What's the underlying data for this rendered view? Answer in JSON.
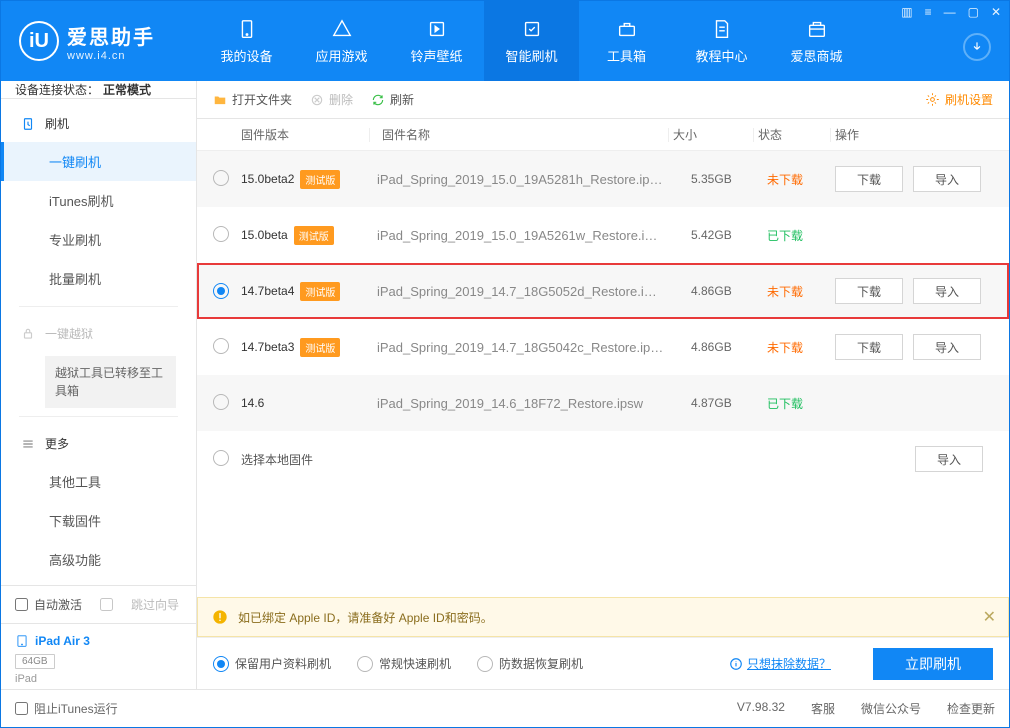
{
  "brand": {
    "cn": "爱思助手",
    "url": "www.i4.cn",
    "logo_letter": "iU"
  },
  "nav": [
    {
      "label": "我的设备"
    },
    {
      "label": "应用游戏"
    },
    {
      "label": "铃声壁纸"
    },
    {
      "label": "智能刷机"
    },
    {
      "label": "工具箱"
    },
    {
      "label": "教程中心"
    },
    {
      "label": "爱思商城"
    }
  ],
  "nav_active_index": 3,
  "conn_status": {
    "label": "设备连接状态：",
    "value": "正常模式"
  },
  "sidebar": {
    "flash": {
      "title": "刷机",
      "items": [
        "一键刷机",
        "iTunes刷机",
        "专业刷机",
        "批量刷机"
      ],
      "selected": 0
    },
    "jailbreak": {
      "title": "一键越狱",
      "note": "越狱工具已转移至工具箱"
    },
    "more": {
      "title": "更多",
      "items": [
        "其他工具",
        "下载固件",
        "高级功能"
      ]
    },
    "auto_activate": "自动激活",
    "skip_guide": "跳过向导",
    "device": {
      "name": "iPad Air 3",
      "capacity": "64GB",
      "model": "iPad"
    }
  },
  "toolbar": {
    "open": "打开文件夹",
    "delete": "删除",
    "refresh": "刷新",
    "settings": "刷机设置"
  },
  "thead": {
    "version": "固件版本",
    "name": "固件名称",
    "size": "大小",
    "status": "状态",
    "ops": "操作"
  },
  "beta_tag": "测试版",
  "rows": [
    {
      "ver": "15.0beta2",
      "beta": true,
      "name": "iPad_Spring_2019_15.0_19A5281h_Restore.ip…",
      "size": "5.35GB",
      "status": "未下载",
      "status_ok": false,
      "ops": true,
      "selected": false
    },
    {
      "ver": "15.0beta",
      "beta": true,
      "name": "iPad_Spring_2019_15.0_19A5261w_Restore.i…",
      "size": "5.42GB",
      "status": "已下载",
      "status_ok": true,
      "ops": false,
      "selected": false
    },
    {
      "ver": "14.7beta4",
      "beta": true,
      "name": "iPad_Spring_2019_14.7_18G5052d_Restore.i…",
      "size": "4.86GB",
      "status": "未下载",
      "status_ok": false,
      "ops": true,
      "selected": true,
      "highlight": true
    },
    {
      "ver": "14.7beta3",
      "beta": true,
      "name": "iPad_Spring_2019_14.7_18G5042c_Restore.ip…",
      "size": "4.86GB",
      "status": "未下载",
      "status_ok": false,
      "ops": true,
      "selected": false
    },
    {
      "ver": "14.6",
      "beta": false,
      "name": "iPad_Spring_2019_14.6_18F72_Restore.ipsw",
      "size": "4.87GB",
      "status": "已下载",
      "status_ok": true,
      "ops": false,
      "selected": false
    }
  ],
  "local_row": {
    "label": "选择本地固件",
    "import": "导入"
  },
  "btn": {
    "download": "下载",
    "import": "导入"
  },
  "alert": "如已绑定 Apple ID，请准备好 Apple ID和密码。",
  "options": [
    {
      "label": "保留用户资料刷机",
      "selected": true
    },
    {
      "label": "常规快速刷机",
      "selected": false
    },
    {
      "label": "防数据恢复刷机",
      "selected": false
    }
  ],
  "erase_link": "只想抹除数据？",
  "flash_now": "立即刷机",
  "footer": {
    "block_itunes": "阻止iTunes运行",
    "version": "V7.98.32",
    "service": "客服",
    "wechat": "微信公众号",
    "update": "检查更新"
  }
}
